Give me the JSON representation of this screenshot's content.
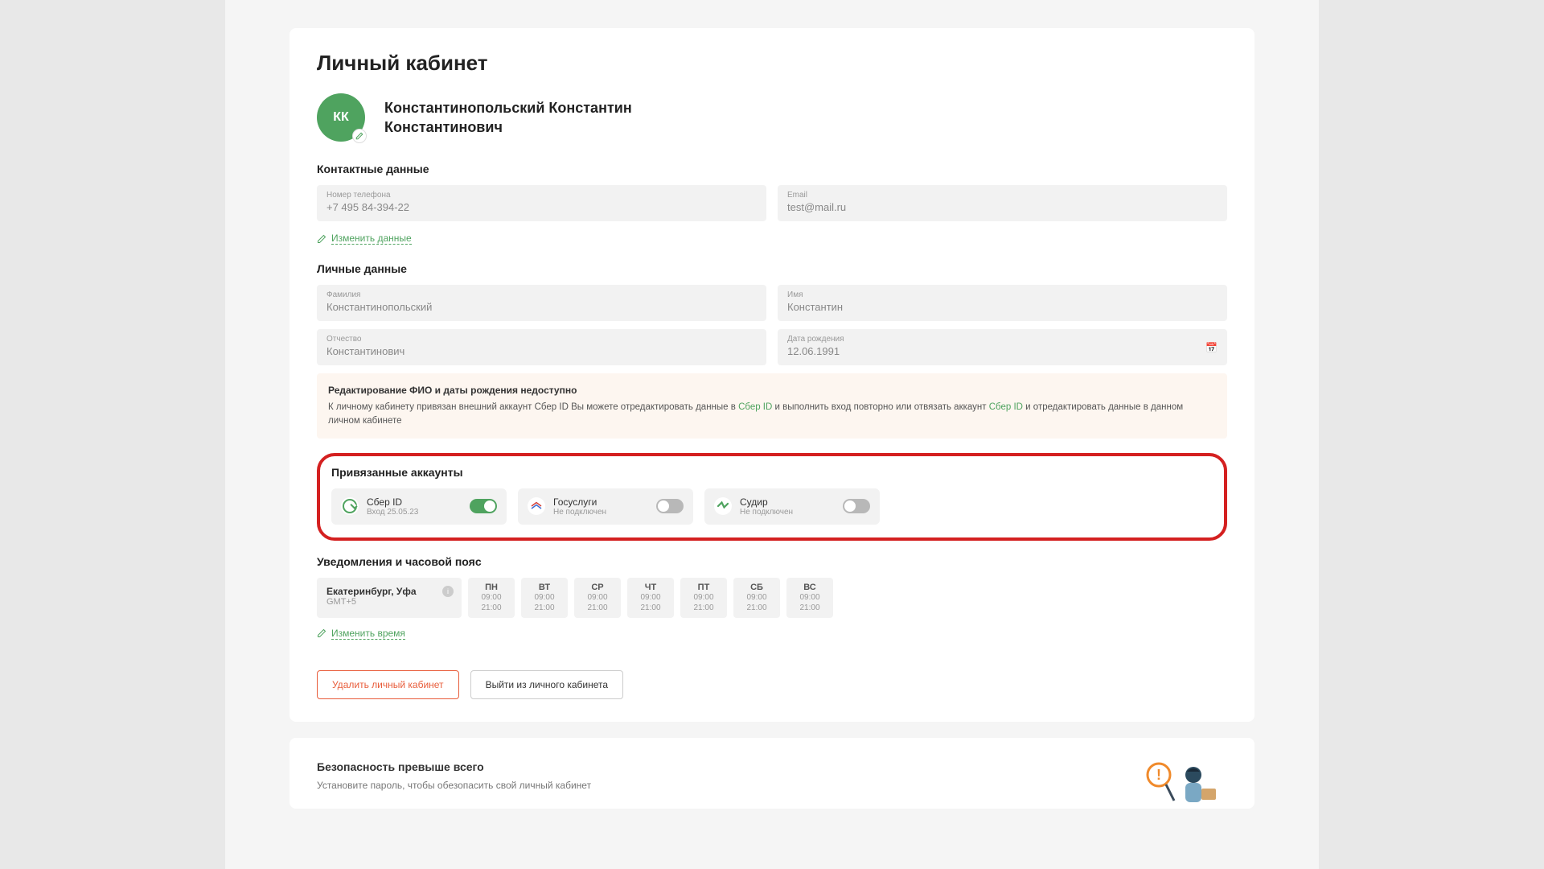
{
  "page": {
    "title": "Личный кабинет"
  },
  "profile": {
    "initials": "КК",
    "full_name_line1": "Константинопольский Константин",
    "full_name_line2": "Константинович"
  },
  "contact": {
    "section": "Контактные данные",
    "phone_label": "Номер телефона",
    "phone_value": "+7 495 84-394-22",
    "email_label": "Email",
    "email_value": "test@mail.ru",
    "edit": "Изменить данные"
  },
  "personal": {
    "section": "Личные данные",
    "lastname_label": "Фамилия",
    "lastname_value": "Константинопольский",
    "firstname_label": "Имя",
    "firstname_value": "Константин",
    "patronymic_label": "Отчество",
    "patronymic_value": "Константинович",
    "birthdate_label": "Дата рождения",
    "birthdate_value": "12.06.1991"
  },
  "notice": {
    "title": "Редактирование ФИО и даты рождения недоступно",
    "text1": "К личному кабинету привязан внешний аккаунт Сбер ID Вы можете отредактировать данные в ",
    "link1": "Сбер ID",
    "text2": " и выполнить вход повторно или отвязать аккаунт ",
    "link2": "Сбер ID",
    "text3": " и отредактировать данные в данном личном кабинете"
  },
  "linked": {
    "section": "Привязанные аккаунты",
    "items": [
      {
        "name": "Сбер ID",
        "sub": "Вход 25.05.23",
        "on": true
      },
      {
        "name": "Госуслуги",
        "sub": "Не подключен",
        "on": false
      },
      {
        "name": "Судир",
        "sub": "Не подключен",
        "on": false
      }
    ]
  },
  "tz": {
    "section": "Уведомления и часовой пояс",
    "city": "Екатеринбург, Уфа",
    "gmt": "GMT+5",
    "days": [
      {
        "d": "ПН",
        "from": "09:00",
        "to": "21:00"
      },
      {
        "d": "ВТ",
        "from": "09:00",
        "to": "21:00"
      },
      {
        "d": "СР",
        "from": "09:00",
        "to": "21:00"
      },
      {
        "d": "ЧТ",
        "from": "09:00",
        "to": "21:00"
      },
      {
        "d": "ПТ",
        "from": "09:00",
        "to": "21:00"
      },
      {
        "d": "СБ",
        "from": "09:00",
        "to": "21:00"
      },
      {
        "d": "ВС",
        "from": "09:00",
        "to": "21:00"
      }
    ],
    "edit": "Изменить время"
  },
  "actions": {
    "delete": "Удалить личный кабинет",
    "logout": "Выйти из личного кабинета"
  },
  "security": {
    "title": "Безопасность превыше всего",
    "desc": "Установите пароль, чтобы обезопасить свой личный кабинет"
  }
}
